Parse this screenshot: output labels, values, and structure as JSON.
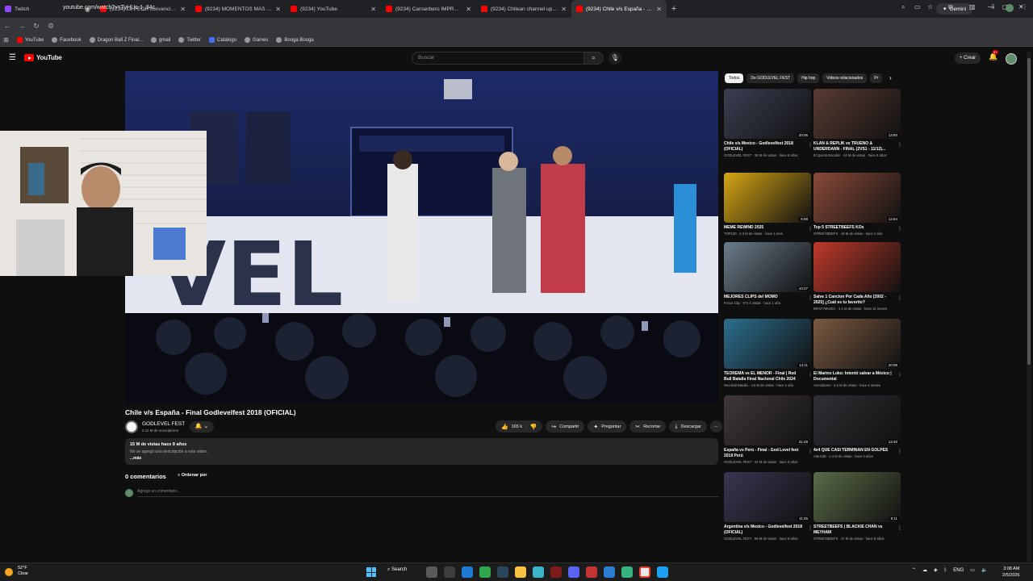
{
  "browser": {
    "tabs": [
      {
        "title": "Twitch",
        "favicon": "twitch"
      },
      {
        "title": "(9234) La PEOR convención FU",
        "favicon": "youtube"
      },
      {
        "title": "(9234) MOMENTOS MÁS PELIG",
        "favicon": "youtube"
      },
      {
        "title": "(9234) YouTube",
        "favicon": "youtube"
      },
      {
        "title": "(9234) Canserbero IMPROVISA",
        "favicon": "youtube"
      },
      {
        "title": "(9234) Chilean channel uploads",
        "favicon": "youtube"
      },
      {
        "title": "(9234) Chile v/s España - Final",
        "favicon": "youtube",
        "active": true
      }
    ],
    "gemini_label": "Gemini",
    "url": "youtube.com/watch?v=TyHUc-1_34c",
    "bookmarks": [
      {
        "label": "YouTube",
        "icon": "youtube"
      },
      {
        "label": "Facebook",
        "icon": "globe"
      },
      {
        "label": "Dragon Ball Z Final...",
        "icon": "globe"
      },
      {
        "label": "gmail",
        "icon": "globe"
      },
      {
        "label": "Twitter",
        "icon": "globe"
      },
      {
        "label": "Catálogo",
        "icon": "catalog"
      },
      {
        "label": "Games",
        "icon": "globe"
      },
      {
        "label": "Booga Booga",
        "icon": "globe"
      }
    ]
  },
  "youtube": {
    "logo_text": "YouTube",
    "search_placeholder": "Buscar",
    "create_label": "+ Crear",
    "notifications_badge": "9+",
    "video": {
      "title": "Chile v/s España - Final Godlevelfest 2018 (OFICIAL)",
      "channel": "GODLEVEL FEST",
      "subscribers": "2.11 M de suscriptores",
      "likes": "165 k",
      "actions": [
        "Compartir",
        "Preguntar",
        "Recortar",
        "Descargar"
      ],
      "views_date": "15 M de vistas  hace 8 años",
      "description": "No se agregó una descripción a este video.",
      "more": "...más",
      "comments_count": "0 comentarios",
      "sort_label": "Ordenar por",
      "comment_placeholder": "Agrega un comentario..."
    },
    "chips": [
      "Todos",
      "De GODLEVEL FEST",
      "Hip hop",
      "Videos relacionados",
      "Pr"
    ],
    "recommendations": [
      {
        "title": "Chile v/s Mexico - Godlevelfest 2018 (OFICIAL)",
        "meta": "GODLEVEL FEST · 38 M de vistas · hace 8 años",
        "duration": "20:06",
        "color": "#3a3f52"
      },
      {
        "title": "KLAN & REPLIK vs TRUENO & UNDERDANN - FINAL (2VS1 - 11/12)...",
        "meta": "El Quinto Escalón · 44 M de vistas · hace 8 años",
        "duration": "13:50",
        "color": "#5a3b33"
      },
      {
        "title": "MEME REWIND 2025",
        "meta": "TOP100 · 2.3 M de vistas · hace 1 mes",
        "duration": "6:58",
        "color": "#d6a514"
      },
      {
        "title": "Top 5 STREETBEEFS KOs",
        "meta": "STREETBEEFS · 10 M de vistas · hace 1 año",
        "duration": "12:54",
        "color": "#8a4a3a"
      },
      {
        "title": "MEJORES CLIPS del MOMO",
        "meta": "Focus Clip · 671 k vistas · hace 1 año",
        "duration": "10:27",
        "color": "#6a7c8a"
      },
      {
        "title": "Salve 1 Cancion Por Cada Año [2002 - 2025] ¿Cuál es tu favorito?",
        "meta": "BRAYYMUSIC · 1.1 M de vistas · hace 11 meses",
        "duration": "",
        "color": "#c0392b"
      },
      {
        "title": "TEOREMA vs EL MENOR - Final | Red Bull Batalla Final Nacional Chile 2024",
        "meta": "Red Bull Batalla · 4.5 M de vistas · hace 1 año",
        "duration": "14:11",
        "color": "#2c6f8f"
      },
      {
        "title": "El Marino Loko: Intentó salvar a México | Documental",
        "meta": "Arenitdores · 2.0 M de vistas · hace 4 meses",
        "duration": "20:08",
        "color": "#7a5a42"
      },
      {
        "title": "España vs Perú - Final - God Level fest 2019 Perú",
        "meta": "GODLEVEL FEST · 41 M de vistas · hace 6 años",
        "duration": "31:29",
        "color": "#40383a"
      },
      {
        "title": "4x4 QUE CASI TERMINAN EN GOLPES",
        "meta": "Vita Edit · 2.4 M de vistas · hace 3 años",
        "duration": "12:40",
        "color": "#2f2f35"
      },
      {
        "title": "Argentina v/s Mexico - Godlevelfest 2018 (OFICIAL)",
        "meta": "GODLEVEL FEST · 98 M de vistas · hace 8 años",
        "duration": "11:45",
        "color": "#3b3552"
      },
      {
        "title": "STREETBEEFS | BLACKIE CHAN vs MEYHAM",
        "meta": "STREETBEEFS · 17 M de vistas · hace 8 años",
        "duration": "9:11",
        "color": "#5b6b48"
      }
    ]
  },
  "taskbar": {
    "weather_temp": "52°F",
    "weather_desc": "Clear",
    "search_label": "Search",
    "lang": "ENG",
    "time": "3:08 AM",
    "date": "2/5/2026"
  }
}
